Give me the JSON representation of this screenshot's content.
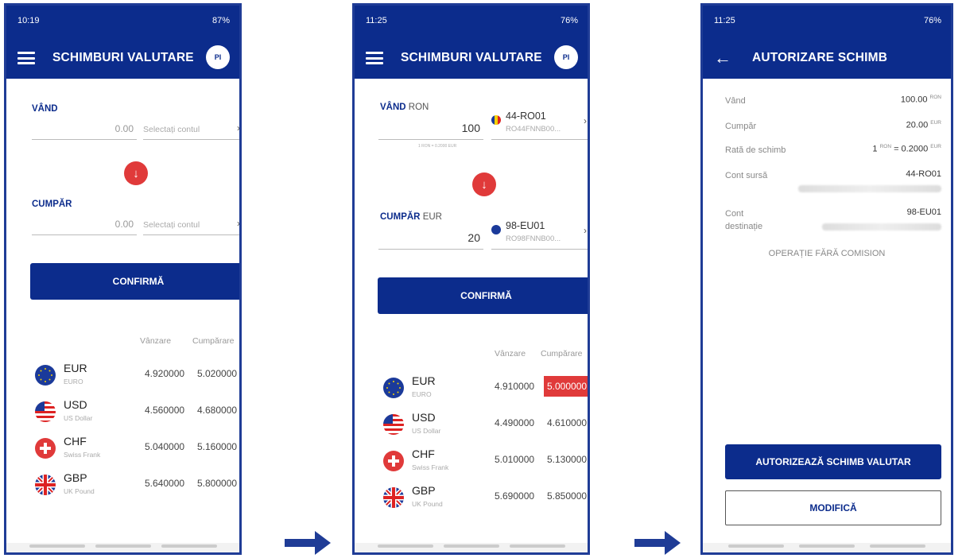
{
  "screen1": {
    "status_time": "10:19",
    "status_right": "87%",
    "title": "SCHIMBURI VALUTARE",
    "avatar": "PI",
    "sell_label": "VÂND",
    "sell_amount": "0.00",
    "sell_account_placeholder": "Selectați contul",
    "buy_label": "CUMPĂR",
    "buy_amount": "0.00",
    "buy_account_placeholder": "Selectați contul",
    "confirm": "CONFIRMĂ",
    "col_sell": "Vânzare",
    "col_buy": "Cumpărare",
    "rates": [
      {
        "code": "EUR",
        "name": "EURO",
        "sell": "4.920000",
        "buy": "5.020000"
      },
      {
        "code": "USD",
        "name": "US Dollar",
        "sell": "4.560000",
        "buy": "4.680000"
      },
      {
        "code": "CHF",
        "name": "Swiss Frank",
        "sell": "5.040000",
        "buy": "5.160000"
      },
      {
        "code": "GBP",
        "name": "UK Pound",
        "sell": "5.640000",
        "buy": "5.800000"
      }
    ]
  },
  "screen2": {
    "status_time": "11:25",
    "status_right": "76%",
    "title": "SCHIMBURI VALUTARE",
    "avatar": "PI",
    "sell_label": "VÂND",
    "sell_currency": "RON",
    "sell_amount": "100",
    "sell_account_code": "44-RO01",
    "sell_account_iban": "RO44FNNB00...",
    "rate_hint": "1 RON = 0.2000 EUR",
    "buy_label": "CUMPĂR",
    "buy_currency": "EUR",
    "buy_amount": "20",
    "buy_account_code": "98-EU01",
    "buy_account_iban": "RO98FNNB00...",
    "confirm": "CONFIRMĂ",
    "col_sell": "Vânzare",
    "col_buy": "Cumpărare",
    "rates": [
      {
        "code": "EUR",
        "name": "EURO",
        "sell": "4.910000",
        "buy": "5.000000"
      },
      {
        "code": "USD",
        "name": "US Dollar",
        "sell": "4.490000",
        "buy": "4.610000"
      },
      {
        "code": "CHF",
        "name": "Swiss Frank",
        "sell": "5.010000",
        "buy": "5.130000"
      },
      {
        "code": "GBP",
        "name": "UK Pound",
        "sell": "5.690000",
        "buy": "5.850000"
      }
    ]
  },
  "screen3": {
    "status_time": "11:25",
    "status_right": "76%",
    "title": "AUTORIZARE SCHIMB",
    "sell_label": "Vând",
    "sell_value": "100.00",
    "sell_unit": "RON",
    "buy_label": "Cumpăr",
    "buy_value": "20.00",
    "buy_unit": "EUR",
    "rate_label": "Rată de schimb",
    "rate_value_prefix": "1",
    "rate_unit_from": "RON",
    "rate_value_mid": "= 0.2000",
    "rate_unit_to": "EUR",
    "source_label": "Cont sursă",
    "source_value": "44-RO01",
    "dest_label_1": "Cont",
    "dest_label_2": "destinație",
    "dest_value": "98-EU01",
    "no_commission": "OPERAȚIE FĂRĂ COMISION",
    "authorize": "AUTORIZEAZĂ SCHIMB VALUTAR",
    "modify": "MODIFICĂ"
  },
  "colors": {
    "brand_blue": "#0c2c8c",
    "accent_red": "#e03a3a"
  },
  "icons": {
    "menu": "hamburger-menu-icon",
    "swap": "arrow-down-icon",
    "back": "arrow-left-icon",
    "flow": "arrow-right-icon"
  }
}
